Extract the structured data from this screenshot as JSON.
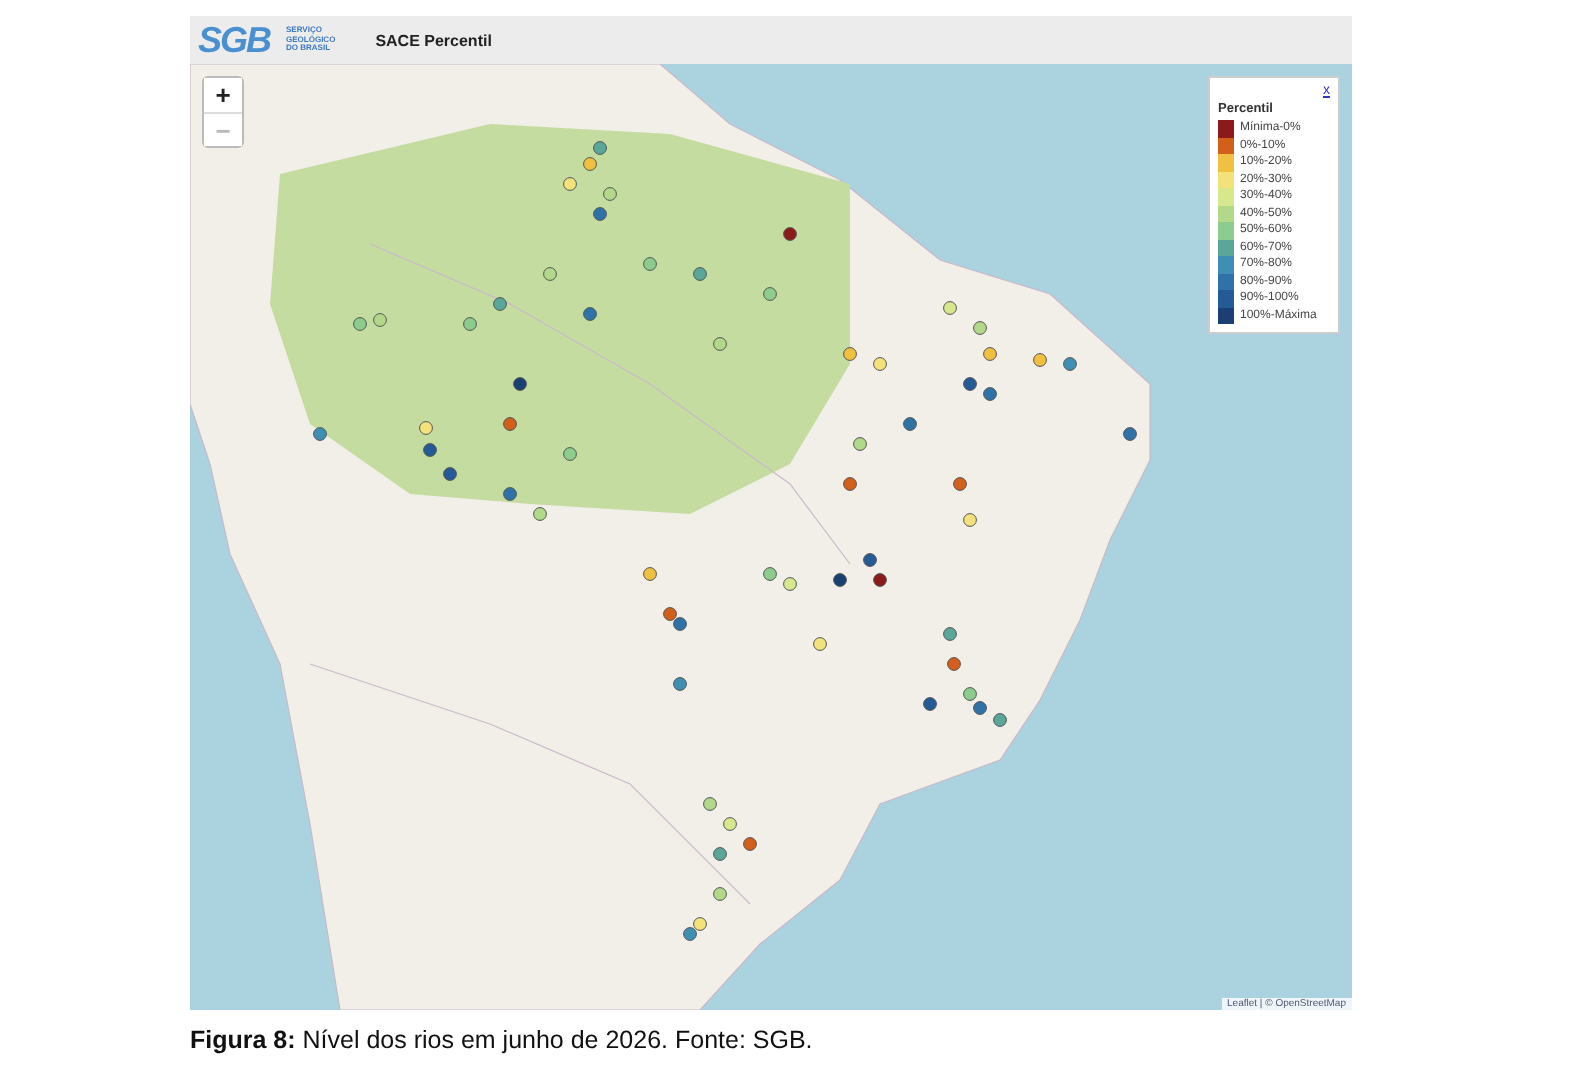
{
  "header": {
    "logo_mark": "SGB",
    "logo_lines": [
      "SERVIÇO",
      "GEOLÓGICO",
      "DO BRASIL"
    ],
    "title": "SACE Percentil"
  },
  "map": {
    "zoom_in": "+",
    "zoom_out": "−",
    "attribution": "Leaflet | © OpenStreetMap"
  },
  "legend": {
    "close": "x",
    "title": "Percentil",
    "items": [
      {
        "label": "Mínima-0%",
        "color": "#8b1a1a"
      },
      {
        "label": "0%-10%",
        "color": "#d2601a"
      },
      {
        "label": "10%-20%",
        "color": "#f0c040"
      },
      {
        "label": "20%-30%",
        "color": "#f3e27a"
      },
      {
        "label": "30%-40%",
        "color": "#d7e88c"
      },
      {
        "label": "40%-50%",
        "color": "#b2d88a"
      },
      {
        "label": "50%-60%",
        "color": "#8ccc8c"
      },
      {
        "label": "60%-70%",
        "color": "#5aa79a"
      },
      {
        "label": "70%-80%",
        "color": "#3f8fb5"
      },
      {
        "label": "80%-90%",
        "color": "#2f72a8"
      },
      {
        "label": "90%-100%",
        "color": "#245a95"
      },
      {
        "label": "100%-Máxima",
        "color": "#1b3f73"
      }
    ]
  },
  "caption": "**Figura 8:** Nível dos rios em junho de 2026. Fonte: SGB."
}
